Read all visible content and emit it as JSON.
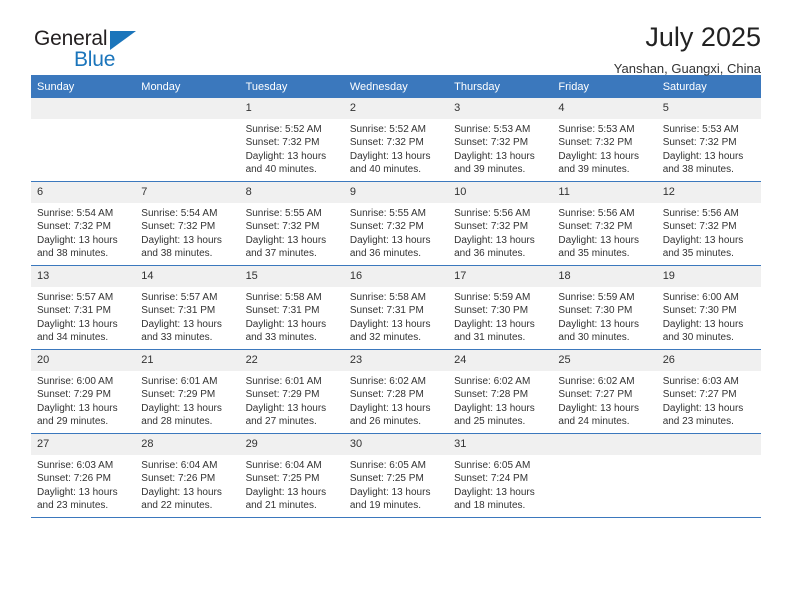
{
  "brand": {
    "name_part1": "General",
    "name_part2": "Blue"
  },
  "header": {
    "title": "July 2025",
    "subtitle": "Yanshan, Guangxi, China"
  },
  "weekday_headers": [
    "Sunday",
    "Monday",
    "Tuesday",
    "Wednesday",
    "Thursday",
    "Friday",
    "Saturday"
  ],
  "colors": {
    "header_blue": "#3b78bd",
    "daynum_band": "#f0f0f0",
    "brand_blue": "#1b75bb",
    "text": "#333333"
  },
  "labels": {
    "sunrise_prefix": "Sunrise: ",
    "sunset_prefix": "Sunset: ",
    "daylight_prefix": "Daylight: "
  },
  "weeks": [
    [
      {
        "day": "",
        "empty": true
      },
      {
        "day": "",
        "empty": true
      },
      {
        "day": "1",
        "sunrise": "Sunrise: 5:52 AM",
        "sunset": "Sunset: 7:32 PM",
        "daylight1": "Daylight: 13 hours",
        "daylight2": "and 40 minutes."
      },
      {
        "day": "2",
        "sunrise": "Sunrise: 5:52 AM",
        "sunset": "Sunset: 7:32 PM",
        "daylight1": "Daylight: 13 hours",
        "daylight2": "and 40 minutes."
      },
      {
        "day": "3",
        "sunrise": "Sunrise: 5:53 AM",
        "sunset": "Sunset: 7:32 PM",
        "daylight1": "Daylight: 13 hours",
        "daylight2": "and 39 minutes."
      },
      {
        "day": "4",
        "sunrise": "Sunrise: 5:53 AM",
        "sunset": "Sunset: 7:32 PM",
        "daylight1": "Daylight: 13 hours",
        "daylight2": "and 39 minutes."
      },
      {
        "day": "5",
        "sunrise": "Sunrise: 5:53 AM",
        "sunset": "Sunset: 7:32 PM",
        "daylight1": "Daylight: 13 hours",
        "daylight2": "and 38 minutes."
      }
    ],
    [
      {
        "day": "6",
        "sunrise": "Sunrise: 5:54 AM",
        "sunset": "Sunset: 7:32 PM",
        "daylight1": "Daylight: 13 hours",
        "daylight2": "and 38 minutes."
      },
      {
        "day": "7",
        "sunrise": "Sunrise: 5:54 AM",
        "sunset": "Sunset: 7:32 PM",
        "daylight1": "Daylight: 13 hours",
        "daylight2": "and 38 minutes."
      },
      {
        "day": "8",
        "sunrise": "Sunrise: 5:55 AM",
        "sunset": "Sunset: 7:32 PM",
        "daylight1": "Daylight: 13 hours",
        "daylight2": "and 37 minutes."
      },
      {
        "day": "9",
        "sunrise": "Sunrise: 5:55 AM",
        "sunset": "Sunset: 7:32 PM",
        "daylight1": "Daylight: 13 hours",
        "daylight2": "and 36 minutes."
      },
      {
        "day": "10",
        "sunrise": "Sunrise: 5:56 AM",
        "sunset": "Sunset: 7:32 PM",
        "daylight1": "Daylight: 13 hours",
        "daylight2": "and 36 minutes."
      },
      {
        "day": "11",
        "sunrise": "Sunrise: 5:56 AM",
        "sunset": "Sunset: 7:32 PM",
        "daylight1": "Daylight: 13 hours",
        "daylight2": "and 35 minutes."
      },
      {
        "day": "12",
        "sunrise": "Sunrise: 5:56 AM",
        "sunset": "Sunset: 7:32 PM",
        "daylight1": "Daylight: 13 hours",
        "daylight2": "and 35 minutes."
      }
    ],
    [
      {
        "day": "13",
        "sunrise": "Sunrise: 5:57 AM",
        "sunset": "Sunset: 7:31 PM",
        "daylight1": "Daylight: 13 hours",
        "daylight2": "and 34 minutes."
      },
      {
        "day": "14",
        "sunrise": "Sunrise: 5:57 AM",
        "sunset": "Sunset: 7:31 PM",
        "daylight1": "Daylight: 13 hours",
        "daylight2": "and 33 minutes."
      },
      {
        "day": "15",
        "sunrise": "Sunrise: 5:58 AM",
        "sunset": "Sunset: 7:31 PM",
        "daylight1": "Daylight: 13 hours",
        "daylight2": "and 33 minutes."
      },
      {
        "day": "16",
        "sunrise": "Sunrise: 5:58 AM",
        "sunset": "Sunset: 7:31 PM",
        "daylight1": "Daylight: 13 hours",
        "daylight2": "and 32 minutes."
      },
      {
        "day": "17",
        "sunrise": "Sunrise: 5:59 AM",
        "sunset": "Sunset: 7:30 PM",
        "daylight1": "Daylight: 13 hours",
        "daylight2": "and 31 minutes."
      },
      {
        "day": "18",
        "sunrise": "Sunrise: 5:59 AM",
        "sunset": "Sunset: 7:30 PM",
        "daylight1": "Daylight: 13 hours",
        "daylight2": "and 30 minutes."
      },
      {
        "day": "19",
        "sunrise": "Sunrise: 6:00 AM",
        "sunset": "Sunset: 7:30 PM",
        "daylight1": "Daylight: 13 hours",
        "daylight2": "and 30 minutes."
      }
    ],
    [
      {
        "day": "20",
        "sunrise": "Sunrise: 6:00 AM",
        "sunset": "Sunset: 7:29 PM",
        "daylight1": "Daylight: 13 hours",
        "daylight2": "and 29 minutes."
      },
      {
        "day": "21",
        "sunrise": "Sunrise: 6:01 AM",
        "sunset": "Sunset: 7:29 PM",
        "daylight1": "Daylight: 13 hours",
        "daylight2": "and 28 minutes."
      },
      {
        "day": "22",
        "sunrise": "Sunrise: 6:01 AM",
        "sunset": "Sunset: 7:29 PM",
        "daylight1": "Daylight: 13 hours",
        "daylight2": "and 27 minutes."
      },
      {
        "day": "23",
        "sunrise": "Sunrise: 6:02 AM",
        "sunset": "Sunset: 7:28 PM",
        "daylight1": "Daylight: 13 hours",
        "daylight2": "and 26 minutes."
      },
      {
        "day": "24",
        "sunrise": "Sunrise: 6:02 AM",
        "sunset": "Sunset: 7:28 PM",
        "daylight1": "Daylight: 13 hours",
        "daylight2": "and 25 minutes."
      },
      {
        "day": "25",
        "sunrise": "Sunrise: 6:02 AM",
        "sunset": "Sunset: 7:27 PM",
        "daylight1": "Daylight: 13 hours",
        "daylight2": "and 24 minutes."
      },
      {
        "day": "26",
        "sunrise": "Sunrise: 6:03 AM",
        "sunset": "Sunset: 7:27 PM",
        "daylight1": "Daylight: 13 hours",
        "daylight2": "and 23 minutes."
      }
    ],
    [
      {
        "day": "27",
        "sunrise": "Sunrise: 6:03 AM",
        "sunset": "Sunset: 7:26 PM",
        "daylight1": "Daylight: 13 hours",
        "daylight2": "and 23 minutes."
      },
      {
        "day": "28",
        "sunrise": "Sunrise: 6:04 AM",
        "sunset": "Sunset: 7:26 PM",
        "daylight1": "Daylight: 13 hours",
        "daylight2": "and 22 minutes."
      },
      {
        "day": "29",
        "sunrise": "Sunrise: 6:04 AM",
        "sunset": "Sunset: 7:25 PM",
        "daylight1": "Daylight: 13 hours",
        "daylight2": "and 21 minutes."
      },
      {
        "day": "30",
        "sunrise": "Sunrise: 6:05 AM",
        "sunset": "Sunset: 7:25 PM",
        "daylight1": "Daylight: 13 hours",
        "daylight2": "and 19 minutes."
      },
      {
        "day": "31",
        "sunrise": "Sunrise: 6:05 AM",
        "sunset": "Sunset: 7:24 PM",
        "daylight1": "Daylight: 13 hours",
        "daylight2": "and 18 minutes."
      },
      {
        "day": "",
        "empty": true
      },
      {
        "day": "",
        "empty": true
      }
    ]
  ]
}
